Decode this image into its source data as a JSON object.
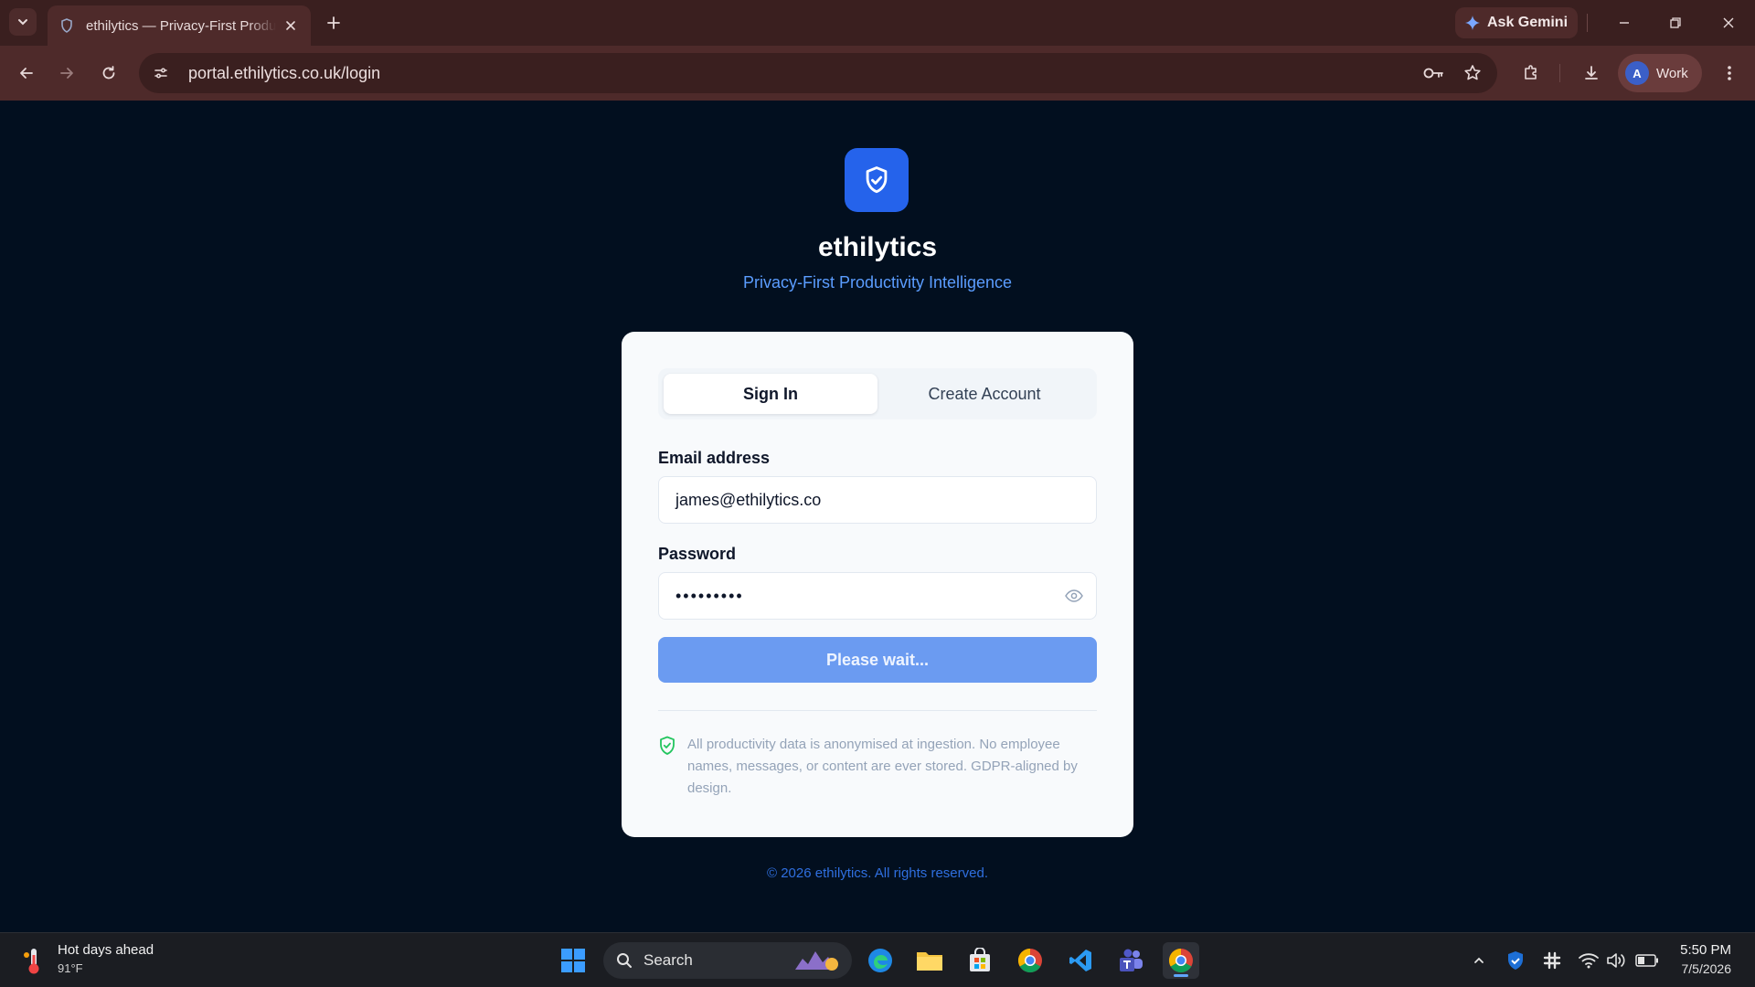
{
  "browser": {
    "tab_title": "ethilytics — Privacy-First Productivity Intelligence",
    "url": "portal.ethilytics.co.uk/login",
    "ask_gemini_label": "Ask Gemini",
    "profile_initial": "A",
    "profile_label": "Work"
  },
  "page": {
    "brand": "ethilytics",
    "tagline": "Privacy-First Productivity Intelligence",
    "brand_color": "#2563eb",
    "auth_tabs": {
      "sign_in": "Sign In",
      "create_account": "Create Account",
      "active": "sign_in"
    },
    "email": {
      "label": "Email address",
      "value": "james@ethilytics.co"
    },
    "password": {
      "label": "Password",
      "masked_value": "•••••••••"
    },
    "submit_label": "Please wait...",
    "privacy_notice": "All productivity data is anonymised at ingestion. No employee names, messages, or content are ever stored. GDPR-aligned by design.",
    "footer": "© 2026 ethilytics. All rights reserved."
  },
  "taskbar": {
    "weather_title": "Hot days ahead",
    "weather_temp": "91°F",
    "search_label": "Search",
    "time": "5:50 PM",
    "date": "7/5/2026"
  }
}
